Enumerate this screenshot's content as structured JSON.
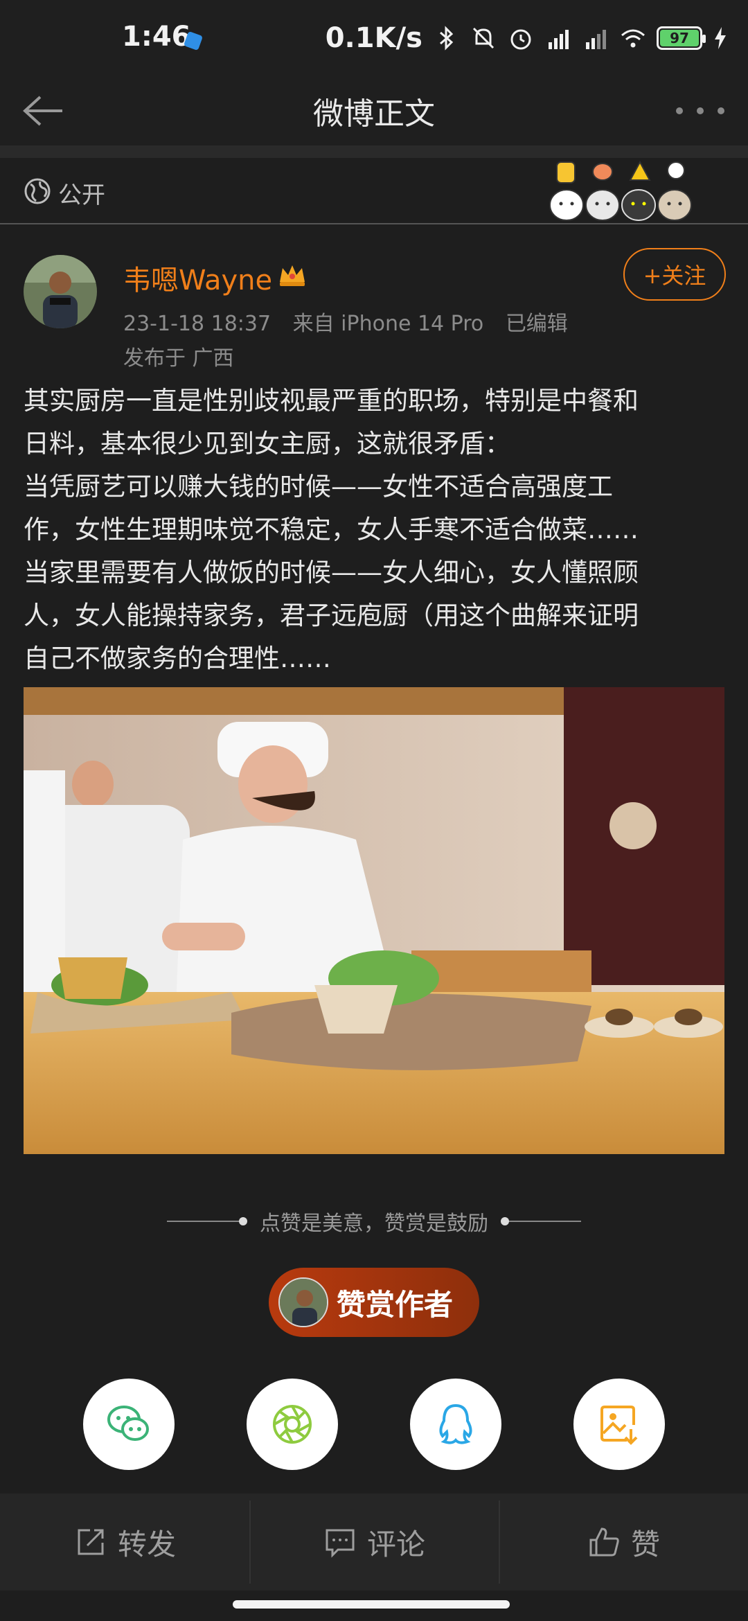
{
  "status_bar": {
    "time": "1:46",
    "network_speed": "0.1K/s",
    "battery_level": "97",
    "icons": [
      "bluetooth-icon",
      "mute-icon",
      "alarm-icon",
      "signal-hd-icon",
      "signal-hd-icon",
      "wifi-icon",
      "battery-icon",
      "charging-icon"
    ]
  },
  "header": {
    "title": "微博正文",
    "back_icon": "back-arrow-icon",
    "more_icon": "more-dots-icon"
  },
  "visibility": {
    "label": "公开",
    "icon": "globe-icon"
  },
  "post": {
    "author_name": "韦嗯Wayne",
    "author_badge_icon": "crown-icon",
    "follow_label": "+关注",
    "time": "23-1-18 18:37",
    "source": "来自 iPhone 14 Pro",
    "edited": "已编辑",
    "location": "发布于 广西",
    "text_lines": [
      "其实厨房一直是性别歧视最严重的职场，特别是中餐和",
      "日料，基本很少见到女主厨，这就很矛盾：",
      "当凭厨艺可以赚大钱的时候——女性不适合高强度工",
      "作，女性生理期味觉不稳定，女人手寒不适合做菜……",
      "当家里需要有人做饭的时候——女人细心，女人懂照顾",
      "人，女人能操持家务，君子远庖厨（用这个曲解来证明",
      "自己不做家务的合理性……"
    ]
  },
  "reward": {
    "tip": "点赞是美意，赞赏是鼓励",
    "button_label": "赞赏作者"
  },
  "share": {
    "items": [
      "wechat-icon",
      "moments-icon",
      "qq-icon",
      "save-image-icon"
    ],
    "colors": {
      "wechat": "#3bb377",
      "moments": "#8ecb3f",
      "qq": "#2aa7e6",
      "save": "#f5a623"
    }
  },
  "bottom_bar": {
    "repost": "转发",
    "comment": "评论",
    "like": "赞"
  },
  "colors": {
    "accent": "#f07f1a",
    "background": "#1e1e1e"
  }
}
